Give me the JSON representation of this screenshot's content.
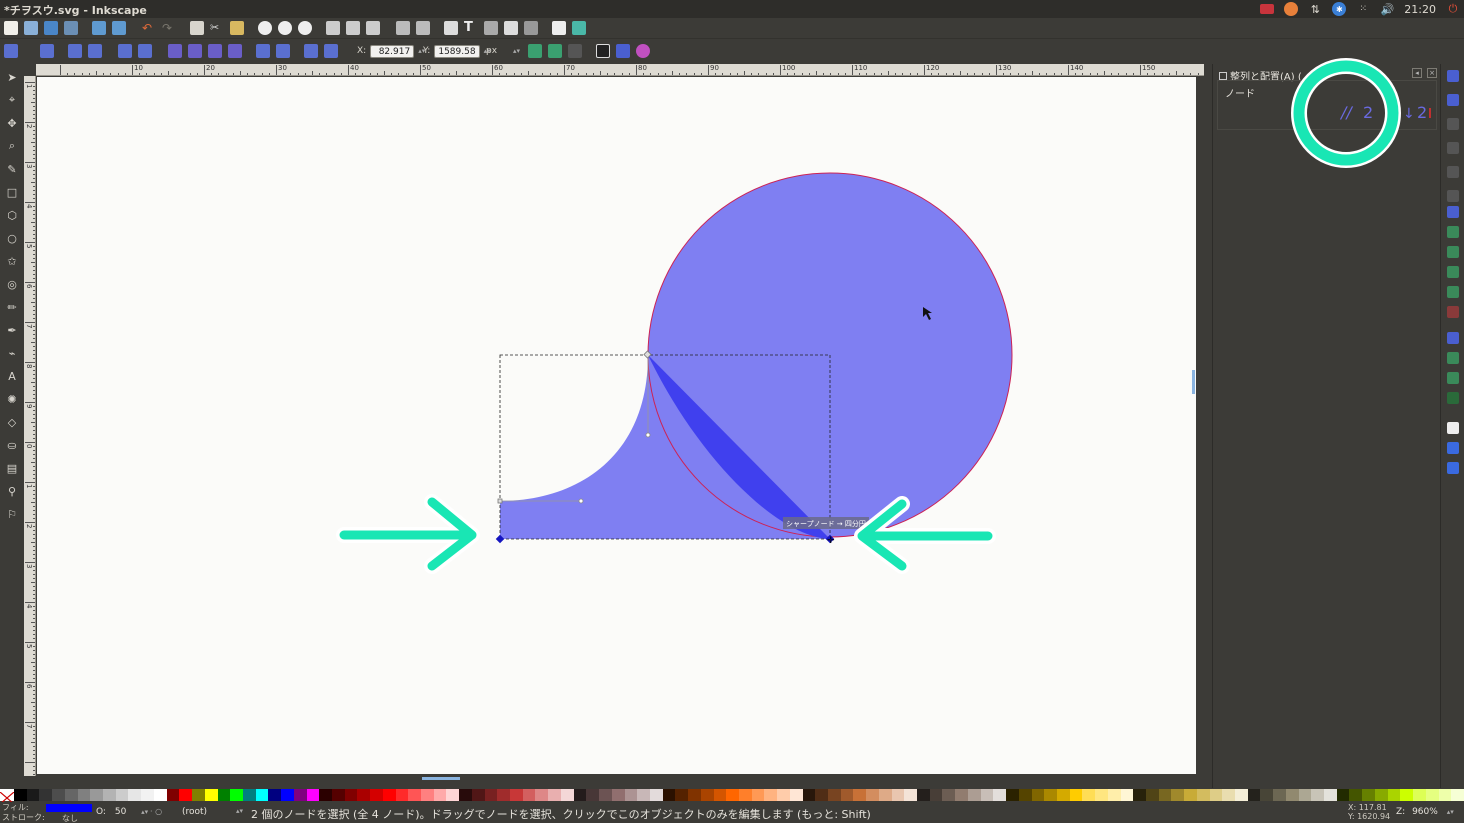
{
  "window": {
    "title": "*チヲスウ.svg - Inkscape"
  },
  "tray": {
    "clock": "21:20"
  },
  "toolbar": {
    "x_label": "X:",
    "x_value": "82.917",
    "y_label": "Y:",
    "y_value": "1589.58",
    "unit": "px"
  },
  "ruler": {
    "h_labels": [
      "10",
      "20",
      "30",
      "40",
      "50",
      "60",
      "70",
      "80",
      "90",
      "100",
      "110",
      "120",
      "130",
      "140",
      "150"
    ],
    "v_labels": [
      "1",
      "2",
      "3",
      "4",
      "5",
      "6",
      "7",
      "8",
      "9",
      "0",
      "1",
      "2",
      "3",
      "4",
      "5",
      "6",
      "7"
    ]
  },
  "canvas": {
    "shape_fill": "#7f7ff2",
    "shape_dark_fill": "#4040ee",
    "circle_stroke": "#cc2255",
    "tooltip": "シャープノード → 四分円"
  },
  "annotation": {
    "color": "#19e6b4"
  },
  "dock": {
    "title": "整列と配置(A) (",
    "section": "ノード"
  },
  "palette": {
    "colors": [
      "#000000",
      "#1a1a1a",
      "#333333",
      "#4d4d4d",
      "#666666",
      "#808080",
      "#999999",
      "#b3b3b3",
      "#cccccc",
      "#e6e6e6",
      "#f2f2f2",
      "#ffffff",
      "#800000",
      "#ff0000",
      "#808000",
      "#ffff00",
      "#008000",
      "#00ff00",
      "#008080",
      "#00ffff",
      "#000080",
      "#0000ff",
      "#800080",
      "#ff00ff",
      "#2b0000",
      "#550000",
      "#800000",
      "#aa0000",
      "#d40000",
      "#ff0000",
      "#ff2a2a",
      "#ff5555",
      "#ff8080",
      "#ffaaaa",
      "#ffd5d5",
      "#280b0b",
      "#501616",
      "#782121",
      "#a02c2c",
      "#c83737",
      "#d35f5f",
      "#de8787",
      "#e9afaf",
      "#f4d7d7",
      "#241c1c",
      "#483737",
      "#6c5353",
      "#916f6f",
      "#ac9393",
      "#c8b7b7",
      "#e3dbdb",
      "#2b1100",
      "#552200",
      "#803300",
      "#aa4400",
      "#d45500",
      "#ff6600",
      "#ff7f2a",
      "#ff9955",
      "#ffb380",
      "#ffccaa",
      "#ffe6d5",
      "#28170b",
      "#502d16",
      "#784421",
      "#a05a2c",
      "#c87137",
      "#d38d5f",
      "#deaa87",
      "#e9c6af",
      "#f4e3d7",
      "#241f1c",
      "#483e37",
      "#6c5d53",
      "#917c6f",
      "#ac9d93",
      "#c8beb7",
      "#e3dedb",
      "#2b2200",
      "#554400",
      "#806600",
      "#aa8800",
      "#d4aa00",
      "#ffcc00",
      "#ffdd55",
      "#ffe680",
      "#ffeeaa",
      "#fff6d5",
      "#28220b",
      "#504416",
      "#786721",
      "#a0892c",
      "#c8ab37",
      "#d3bc5f",
      "#decd87",
      "#e9ddaf",
      "#f4eed7",
      "#24221c",
      "#484537",
      "#6c6753",
      "#91896f",
      "#aca793",
      "#c8c4b7",
      "#e3e2db",
      "#222b00",
      "#445500",
      "#668000",
      "#88aa00",
      "#aad400",
      "#ccff00",
      "#ddff55",
      "#e5ff80",
      "#eeffaa",
      "#f6ffd5"
    ]
  },
  "status": {
    "fill_label": "フィル:",
    "stroke_label": "ストローク:",
    "stroke_value": "なし",
    "fill_color": "#0000ff",
    "opacity_label": "O:",
    "opacity_value": "50",
    "layer": "(root)",
    "message": "2 個のノードを選択 (全 4 ノード)。ドラッグでノードを選択、クリックでこのオブジェクトのみを編集します (もっと: Shift)",
    "cursor_x": "X:   117.81",
    "cursor_y": "Y: 1620.94",
    "zoom_label": "Z:",
    "zoom_value": "960%"
  }
}
